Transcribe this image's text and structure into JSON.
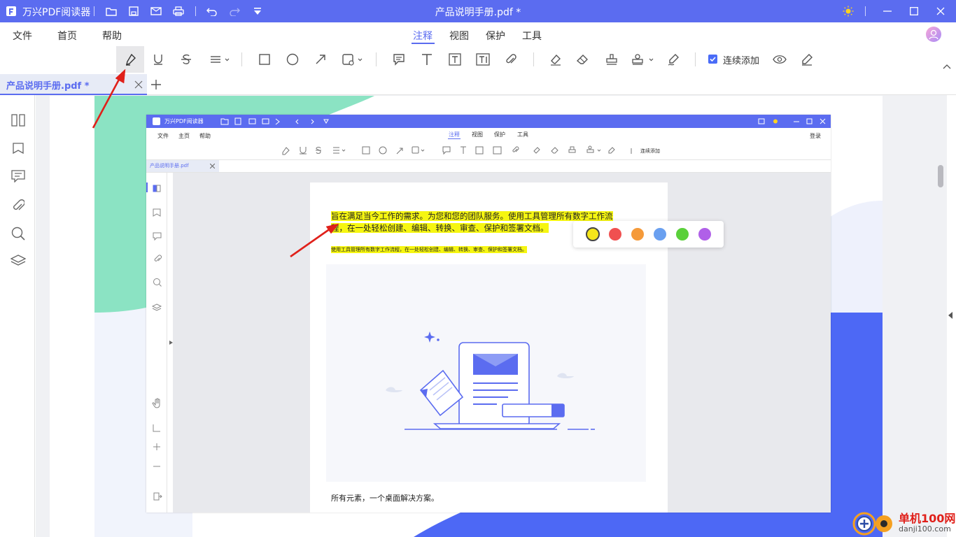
{
  "titlebar": {
    "app_name": "万兴PDF阅读器",
    "document_title": "产品说明手册.pdf *",
    "background_color": "#5b6cf0"
  },
  "menu": {
    "left": [
      "文件",
      "首页",
      "帮助"
    ],
    "tabs": [
      "注释",
      "视图",
      "保护",
      "工具"
    ],
    "active_tab": "注释"
  },
  "toolbar": {
    "continuous_add_label": "连续添加",
    "continuous_add_checked": true
  },
  "doc_tab": {
    "label": "产品说明手册.pdf *"
  },
  "inner_app": {
    "app_name": "万兴PDF阅读器",
    "menu_left": [
      "文件",
      "主页",
      "帮助"
    ],
    "tabs": [
      "注释",
      "视图",
      "保护",
      "工具"
    ],
    "login": "登录",
    "continuous_add": "连续添加",
    "doc_tab": "产品说明手册.pdf",
    "highlight_line1": "旨在满足当今工作的需求。为您和您的团队服务。使用工具管理所有数字工作流",
    "highlight_line2": "程，在一处轻松创建、编辑、转换、审查、保护和签署文档。",
    "small_highlight": "使用工具管理所有数字工作流程，在一处轻松创建、编辑、转换、审查、保护和签署文档。",
    "caption": "所有元素，一个桌面解决方案。"
  },
  "color_palette": [
    "#f5e61a",
    "#f05050",
    "#f59a3a",
    "#6aa0f0",
    "#5ad03a",
    "#b060e8"
  ],
  "watermark": {
    "site_name": "单机100网",
    "site_url": "danji100.com"
  }
}
